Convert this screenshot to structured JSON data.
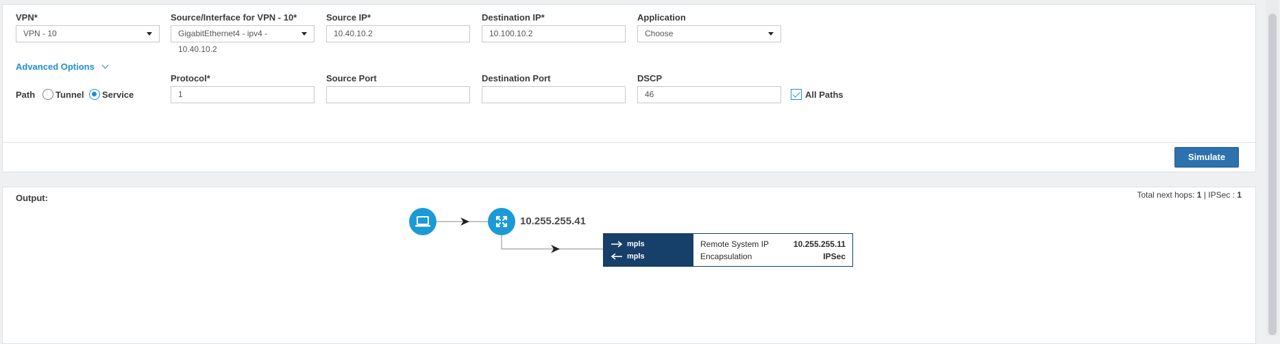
{
  "form": {
    "vpn": {
      "label": "VPN*",
      "value": "VPN - 10"
    },
    "source_interface": {
      "label": "Source/Interface for VPN - 10*",
      "value": "GigabitEthernet4 - ipv4 - 10.40.10.2"
    },
    "source_ip": {
      "label": "Source IP*",
      "value": "10.40.10.2"
    },
    "destination_ip": {
      "label": "Destination IP*",
      "value": "10.100.10.2"
    },
    "application": {
      "label": "Application",
      "value": "Choose"
    },
    "advanced_options_label": "Advanced Options",
    "path": {
      "label": "Path",
      "options": [
        {
          "label": "Tunnel",
          "selected": false
        },
        {
          "label": "Service",
          "selected": true
        }
      ]
    },
    "protocol": {
      "label": "Protocol*",
      "value": "1"
    },
    "source_port": {
      "label": "Source Port",
      "value": ""
    },
    "destination_port": {
      "label": "Destination Port",
      "value": ""
    },
    "dscp": {
      "label": "DSCP",
      "value": "46"
    },
    "all_paths": {
      "label": "All Paths",
      "checked": true
    },
    "simulate_label": "Simulate"
  },
  "output": {
    "title": "Output:",
    "summary": {
      "next_hops_label": "Total next hops:",
      "next_hops": "1",
      "separator": "|",
      "ipsec_label": "IPSec :",
      "ipsec": "1"
    },
    "source_icon": "laptop-icon",
    "router_icon": "router-icon",
    "hop_ip": "10.255.255.41",
    "tunnel": {
      "out_label": "mpls",
      "in_label": "mpls",
      "remote_system_ip_label": "Remote System IP",
      "remote_system_ip": "10.255.255.11",
      "encapsulation_label": "Encapsulation",
      "encapsulation": "IPSec"
    }
  },
  "colors": {
    "accent": "#1d8ed1",
    "button": "#2b72ae",
    "node": "#1b9ad6",
    "tunnel_dark": "#163f69"
  }
}
